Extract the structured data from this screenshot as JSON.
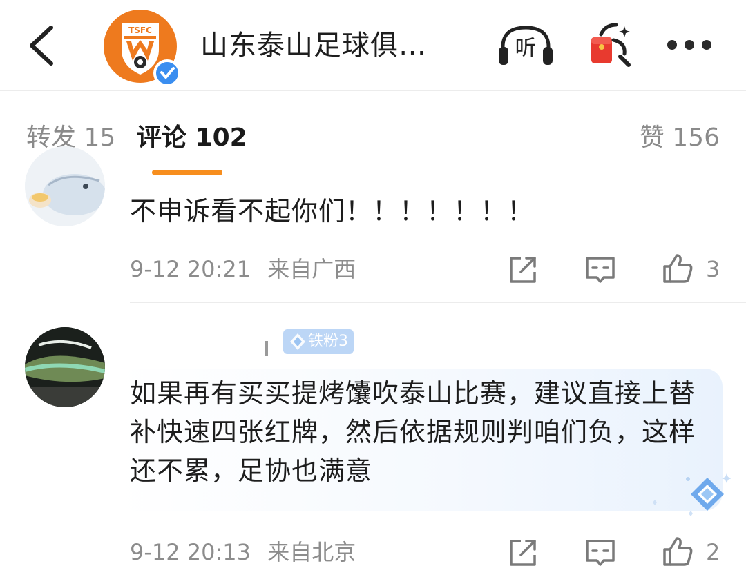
{
  "header": {
    "account_name": "山东泰山足球俱…",
    "listen_label": "听",
    "logo_text": "TSFC"
  },
  "tabs": {
    "reposts": "转发 15",
    "comments": "评论 102",
    "likes": "赞 156"
  },
  "comments": [
    {
      "text": "不申诉看不起你们！！！！！！！",
      "time": "9-12 20:21",
      "location": "来自广西",
      "likes": "3"
    },
    {
      "badge": "铁粉3",
      "text": "如果再有买买提烤馕吹泰山比赛，建议直接上替补快速四张红牌，然后依据规则判咱们负，这样还不累，足协也满意",
      "time": "9-12 20:13",
      "location": "来自北京",
      "likes": "2"
    }
  ],
  "colors": {
    "accent": "#f78e1e",
    "club_orange": "#ee7a1e",
    "verified_blue": "#3a8ef0",
    "redpacket_red": "#e83a2f",
    "muted_text": "#8c8c8c"
  },
  "icons": {
    "back": "back-arrow-icon",
    "listen": "headphones-icon",
    "redpacket": "red-packet-search-icon",
    "more": "more-dots-icon",
    "repost": "repost-icon",
    "reply": "comment-icon",
    "like": "thumbs-up-icon"
  }
}
